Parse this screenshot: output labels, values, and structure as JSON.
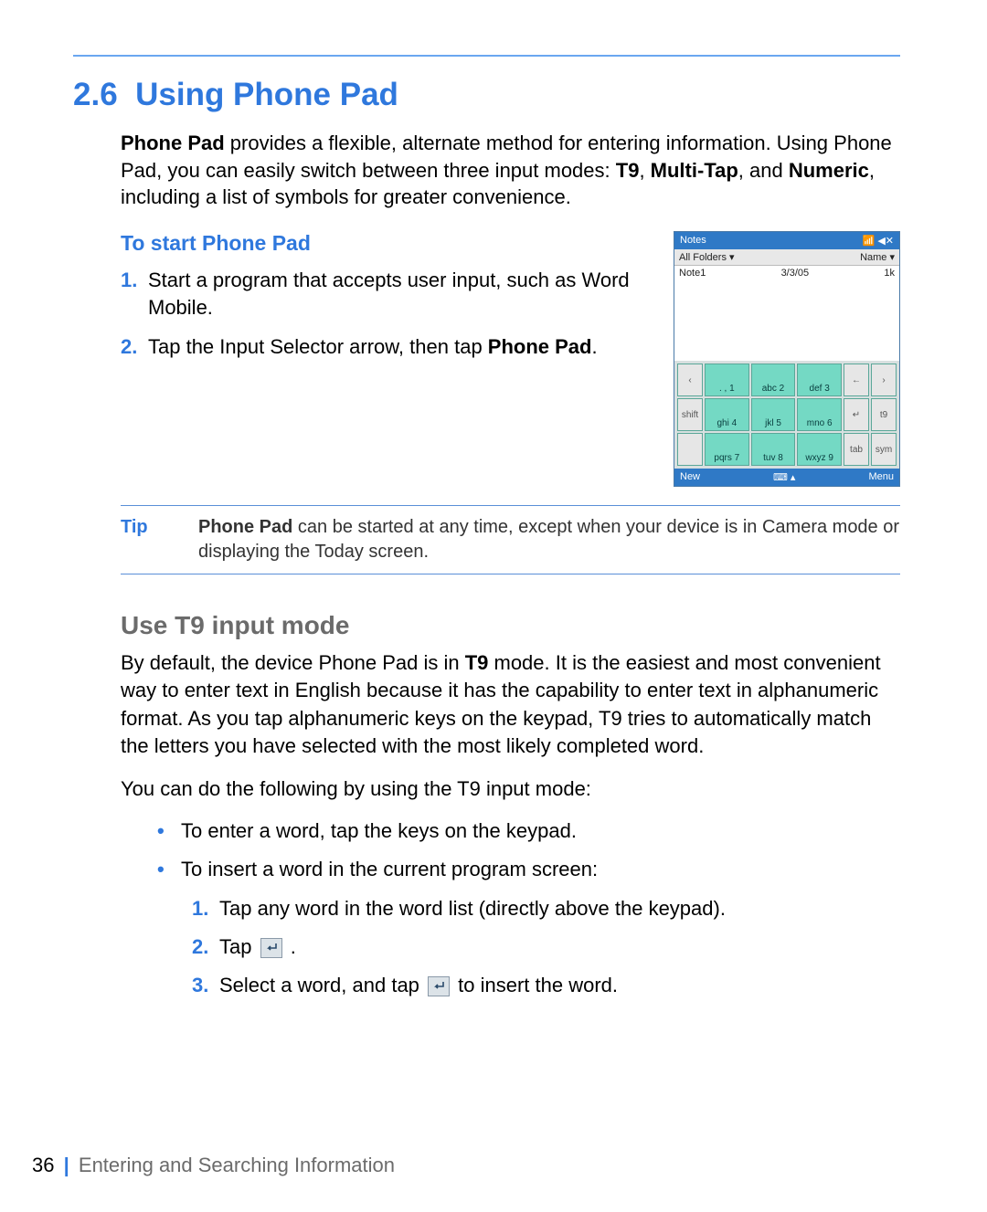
{
  "section_number": "2.6",
  "section_title": "Using Phone Pad",
  "intro_parts": {
    "b1": "Phone Pad",
    "t1": " provides a flexible, alternate method for entering information. Using Phone Pad, you can easily switch between three input modes: ",
    "b2": "T9",
    "t2": ", ",
    "b3": "Multi-Tap",
    "t3": ", and ",
    "b4": "Numeric",
    "t4": ", including a list of symbols for greater convenience."
  },
  "start_heading": "To start Phone Pad",
  "start_steps": [
    {
      "n": "1.",
      "t": "Start a program that accepts user input, such as Word Mobile."
    },
    {
      "n": "2.",
      "t_pre": "Tap the Input Selector arrow, then tap ",
      "t_bold": "Phone Pad",
      "t_post": "."
    }
  ],
  "screenshot": {
    "title": "Notes",
    "bar_left": "All Folders ▾",
    "bar_right": "Name ▾",
    "row_name": "Note1",
    "row_date": "3/3/05",
    "row_size": "1k",
    "keys": {
      "r1": [
        "‹",
        ". , 1",
        "abc 2",
        "def 3",
        "←",
        "›"
      ],
      "r2": [
        "shift",
        "ghi 4",
        "jkl 5",
        "mno 6",
        "↵",
        "t9"
      ],
      "r3": [
        "",
        "pqrs 7",
        "tuv 8",
        "wxyz 9",
        "tab",
        "sym"
      ]
    },
    "foot_left": "New",
    "foot_right": "Menu"
  },
  "tip_label": "Tip",
  "tip_parts": {
    "b1": "Phone Pad",
    "t1": " can be started at any time, except when your device is in Camera mode or displaying the Today screen."
  },
  "t9_heading": "Use T9 input mode",
  "t9_para": {
    "t1": "By default, the device Phone Pad is in ",
    "b1": "T9",
    "t2": " mode. It is the easiest and most convenient way to enter text in English because it has the capability to enter text in alphanumeric format. As you tap alphanumeric keys on the keypad, T9 tries to automatically match the letters you have selected with the most likely completed word."
  },
  "t9_lead": "You can do the following by using the T9 input mode:",
  "t9_bullets": [
    "To enter a word, tap the keys on the keypad.",
    "To insert a word in the current program screen:"
  ],
  "t9_sub": [
    {
      "n": "1.",
      "t": "Tap any word in the word list (directly above the keypad)."
    },
    {
      "n": "2.",
      "t_pre": "Tap ",
      "icon": true,
      "t_post": " ."
    },
    {
      "n": "3.",
      "t_pre": "Select a word, and tap ",
      "icon": true,
      "t_post": " to insert the word."
    }
  ],
  "footer": {
    "page": "36",
    "sep": "|",
    "chapter": "Entering and Searching Information"
  }
}
